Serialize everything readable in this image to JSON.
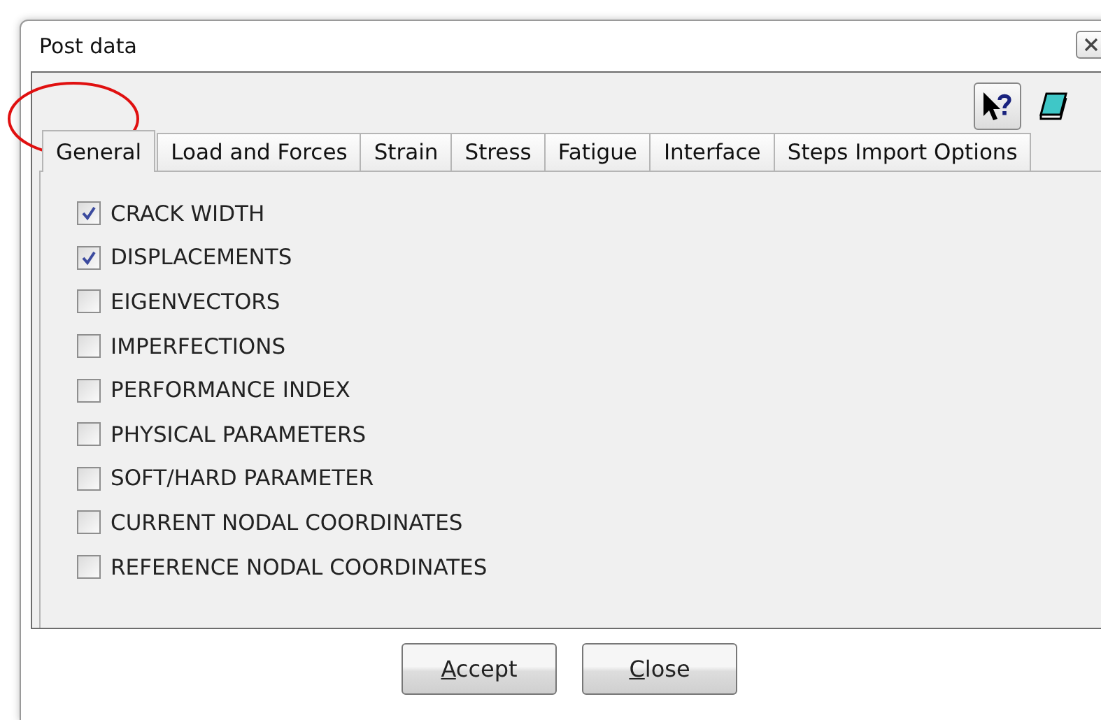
{
  "window": {
    "title": "Post data"
  },
  "tabs": [
    {
      "label": "General",
      "selected": true
    },
    {
      "label": "Load and Forces",
      "selected": false
    },
    {
      "label": "Strain",
      "selected": false
    },
    {
      "label": "Stress",
      "selected": false
    },
    {
      "label": "Fatigue",
      "selected": false
    },
    {
      "label": "Interface",
      "selected": false
    },
    {
      "label": "Steps Import Options",
      "selected": false
    }
  ],
  "options": [
    {
      "label": "CRACK WIDTH",
      "checked": true
    },
    {
      "label": "DISPLACEMENTS",
      "checked": true
    },
    {
      "label": "EIGENVECTORS",
      "checked": false
    },
    {
      "label": "IMPERFECTIONS",
      "checked": false
    },
    {
      "label": "PERFORMANCE INDEX",
      "checked": false
    },
    {
      "label": "PHYSICAL PARAMETERS",
      "checked": false
    },
    {
      "label": "SOFT/HARD PARAMETER",
      "checked": false
    },
    {
      "label": "CURRENT NODAL COORDINATES",
      "checked": false
    },
    {
      "label": "REFERENCE NODAL COORDINATES",
      "checked": false
    }
  ],
  "buttons": [
    {
      "label": "Accept"
    },
    {
      "label": "Close"
    }
  ]
}
